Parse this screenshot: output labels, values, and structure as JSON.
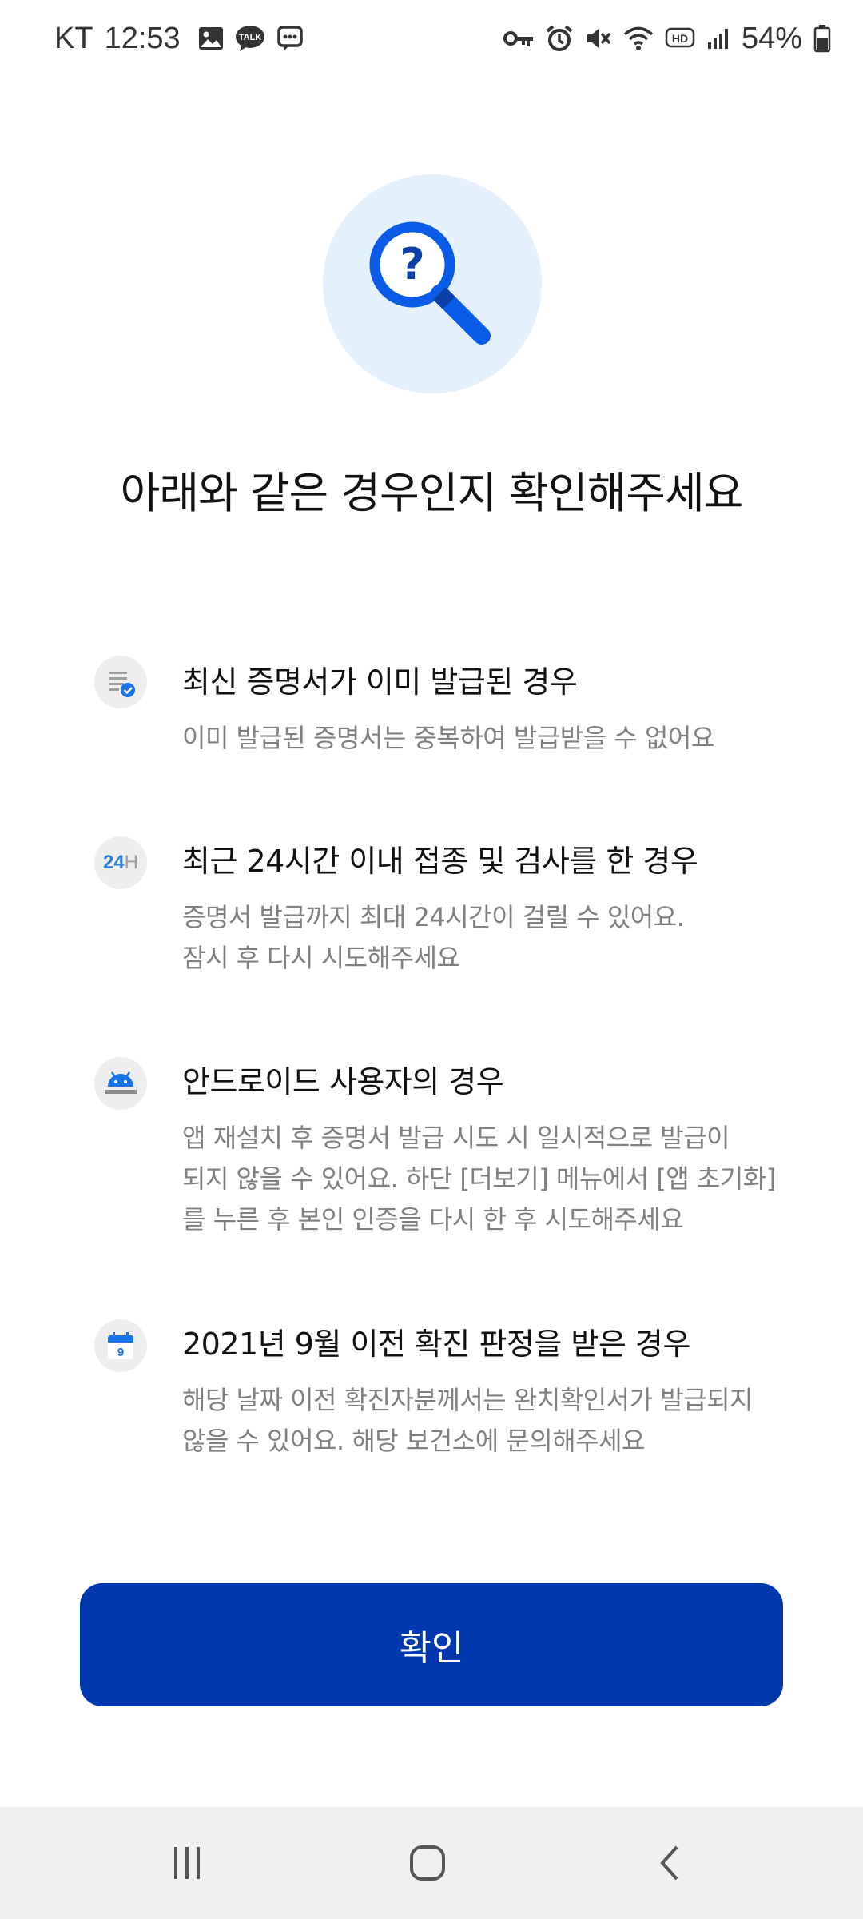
{
  "status_bar": {
    "carrier": "KT",
    "time": "12:53",
    "battery_percent": "54%",
    "battery_level": 0.54,
    "left_icons": [
      "image-icon",
      "talk-icon",
      "message-icon"
    ],
    "right_icons": [
      "key-icon",
      "alarm-icon",
      "mute-icon",
      "wifi-icon",
      "hd-icon",
      "signal-icon",
      "battery-icon"
    ],
    "talk_icon_text": "TALK",
    "hd_icon_text": "HD"
  },
  "hero": {
    "icon": "search-question-icon",
    "title": "아래와 같은 경우인지 확인해주세요"
  },
  "items": [
    {
      "icon": "document-check-icon",
      "title": "최신 증명서가 이미 발급된 경우",
      "description": "이미 발급된 증명서는 중복하여 발급받을 수 없어요"
    },
    {
      "icon": "24h-icon",
      "icon_text_main": "24",
      "icon_text_suffix": "H",
      "title": "최근 24시간 이내 접종 및 검사를 한 경우",
      "description": "증명서 발급까지 최대 24시간이 걸릴 수 있어요.\n잠시 후 다시 시도해주세요"
    },
    {
      "icon": "android-icon",
      "title": "안드로이드 사용자의 경우",
      "description": "앱 재설치 후 증명서 발급 시도 시 일시적으로 발급이\n되지 않을 수 있어요. 하단 [더보기] 메뉴에서 [앱 초기화]\n를 누른 후 본인 인증을 다시 한 후 시도해주세요"
    },
    {
      "icon": "calendar-icon",
      "icon_text": "9",
      "title": "2021년 9월 이전 확진 판정을 받은 경우",
      "description": "해당 날짜 이전 확진자분께서는 완치확인서가 발급되지\n않을 수 있어요. 해당 보건소에 문의해주세요"
    }
  ],
  "confirm_button": {
    "label": "확인"
  },
  "nav_bar": {
    "buttons": [
      "recent-apps-icon",
      "home-icon",
      "back-icon"
    ]
  },
  "colors": {
    "primary": "#0038b0",
    "hero_bg": "#e4f1fc",
    "accent_blue": "#1a73e8",
    "title_text": "#111111",
    "desc_text": "#808080",
    "icon_bg": "#eeeeee",
    "nav_bg": "#f0f0f0"
  }
}
